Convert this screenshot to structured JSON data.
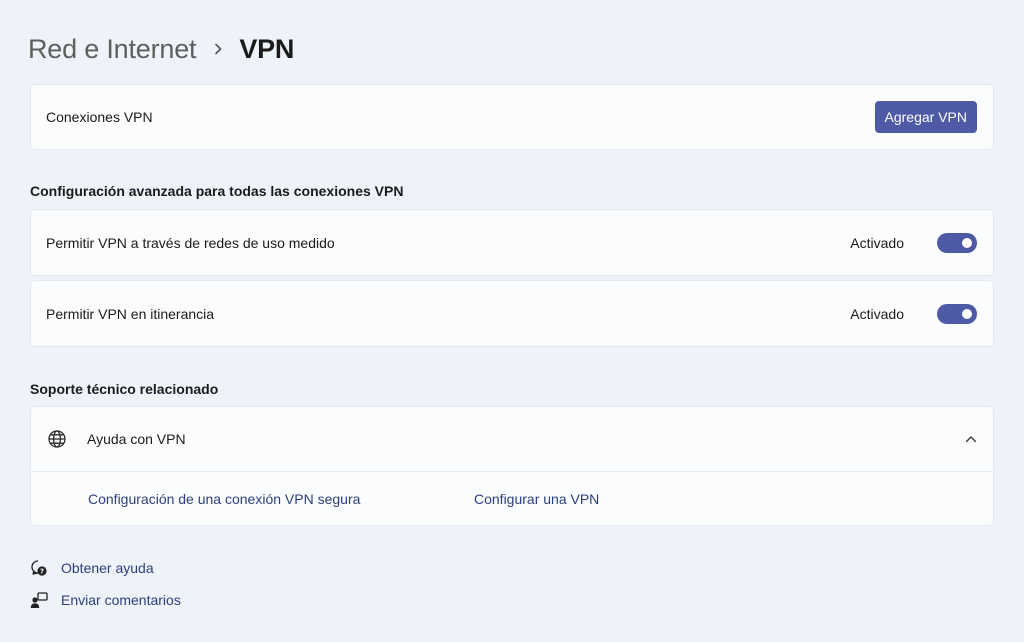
{
  "breadcrumb": {
    "parent": "Red e Internet",
    "separator_icon": "chevron-right-icon",
    "current": "VPN"
  },
  "vpn_connections": {
    "label": "Conexiones VPN",
    "add_button": "Agregar VPN"
  },
  "advanced": {
    "title": "Configuración avanzada para todas las conexiones VPN",
    "settings": [
      {
        "label": "Permitir VPN a través de redes de uso medido",
        "state": "Activado",
        "on": true
      },
      {
        "label": "Permitir VPN en itinerancia",
        "state": "Activado",
        "on": true
      }
    ]
  },
  "support": {
    "title": "Soporte técnico relacionado",
    "help": {
      "icon": "globe-icon",
      "label": "Ayuda con VPN",
      "expand_icon": "chevron-up-icon",
      "links": [
        "Configuración de una conexión VPN segura",
        "Configurar una VPN"
      ]
    }
  },
  "footer": {
    "get_help": {
      "icon": "help-chat-icon",
      "label": "Obtener ayuda"
    },
    "feedback": {
      "icon": "feedback-icon",
      "label": "Enviar comentarios"
    }
  },
  "colors": {
    "accent": "#4e5aa6",
    "background": "#eef2f9",
    "card": "#fbfcfe",
    "link": "#2c3f7a"
  }
}
